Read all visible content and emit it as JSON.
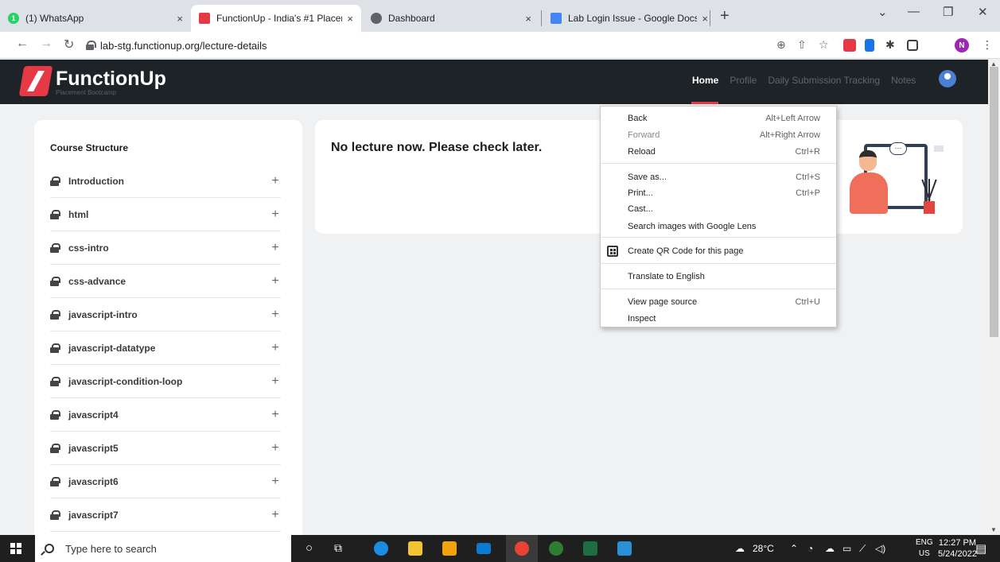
{
  "browser": {
    "tabs": [
      {
        "label": "(1) WhatsApp",
        "icon": "whatsapp-icon",
        "color": "#25d366"
      },
      {
        "label": "FunctionUp - India's #1 Placemer",
        "icon": "functionup-icon",
        "color": "#e63946",
        "active": true
      },
      {
        "label": "Dashboard",
        "icon": "globe-icon",
        "color": "#5f6368"
      },
      {
        "label": "Lab Login Issue - Google Docs",
        "icon": "docs-icon",
        "color": "#4285f4"
      }
    ],
    "close_glyph": "×",
    "new_tab_glyph": "+",
    "url": "lab-stg.functionup.org/lecture-details",
    "profile_initial": "N"
  },
  "site": {
    "brand": "FunctionUp",
    "brand_sub": "Placement Bootcamp",
    "nav": [
      "Home",
      "Profile",
      "Daily Submission Tracking",
      "Notes"
    ],
    "brand_color": "#e63946"
  },
  "course": {
    "title": "Course Structure",
    "items": [
      "Introduction",
      "html",
      "css-intro",
      "css-advance",
      "javascript-intro",
      "javascript-datatype",
      "javascript-condition-loop",
      "javascript4",
      "javascript5",
      "javascript6",
      "javascript7"
    ],
    "expand_glyph": "+"
  },
  "lecture": {
    "message": "No lecture now. Please check later."
  },
  "context_menu": {
    "items": [
      {
        "label": "Back",
        "shortcut": "Alt+Left Arrow"
      },
      {
        "label": "Forward",
        "shortcut": "Alt+Right Arrow",
        "disabled": true
      },
      {
        "label": "Reload",
        "shortcut": "Ctrl+R"
      },
      {
        "label": "Save as...",
        "shortcut": "Ctrl+S"
      },
      {
        "label": "Print...",
        "shortcut": "Ctrl+P"
      },
      {
        "label": "Cast...",
        "shortcut": ""
      },
      {
        "label": "Search images with Google Lens",
        "shortcut": ""
      },
      {
        "label": "Create QR Code for this page",
        "shortcut": ""
      },
      {
        "label": "Translate to English",
        "shortcut": ""
      },
      {
        "label": "View page source",
        "shortcut": "Ctrl+U"
      },
      {
        "label": "Inspect",
        "shortcut": ""
      }
    ]
  },
  "taskbar": {
    "search_placeholder": "Type here to search",
    "weather": "28°C",
    "lang_top": "ENG",
    "lang_bottom": "US",
    "time": "12:27 PM",
    "date": "5/24/2022"
  }
}
